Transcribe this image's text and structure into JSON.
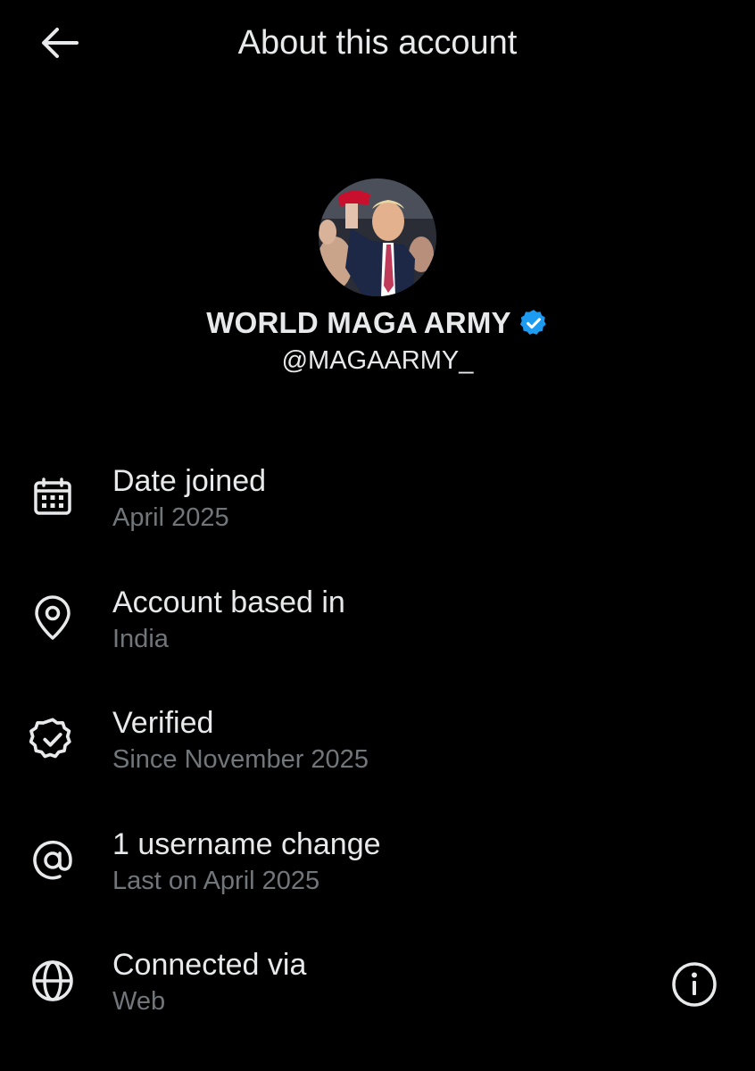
{
  "header": {
    "title": "About this account",
    "back_icon": "arrow-left-icon"
  },
  "profile": {
    "display_name": "WORLD MAGA ARMY",
    "handle": "@MAGAARMY_",
    "verified_badge_color": "#1d9bf0",
    "avatar": "profile-photo"
  },
  "rows": [
    {
      "icon": "calendar-icon",
      "label": "Date joined",
      "sub": "April 2025"
    },
    {
      "icon": "location-pin-icon",
      "label": "Account based in",
      "sub": "India"
    },
    {
      "icon": "verified-badge-icon",
      "label": "Verified",
      "sub": "Since November 2025",
      "action_icon": "info-icon"
    },
    {
      "icon": "at-sign-icon",
      "label": "1 username change",
      "sub": "Last on April 2025"
    },
    {
      "icon": "globe-icon",
      "label": "Connected via",
      "sub": "Web"
    }
  ],
  "colors": {
    "background": "#000000",
    "primary_text": "#e7e9ea",
    "secondary_text": "#71767b",
    "accent": "#1d9bf0"
  }
}
